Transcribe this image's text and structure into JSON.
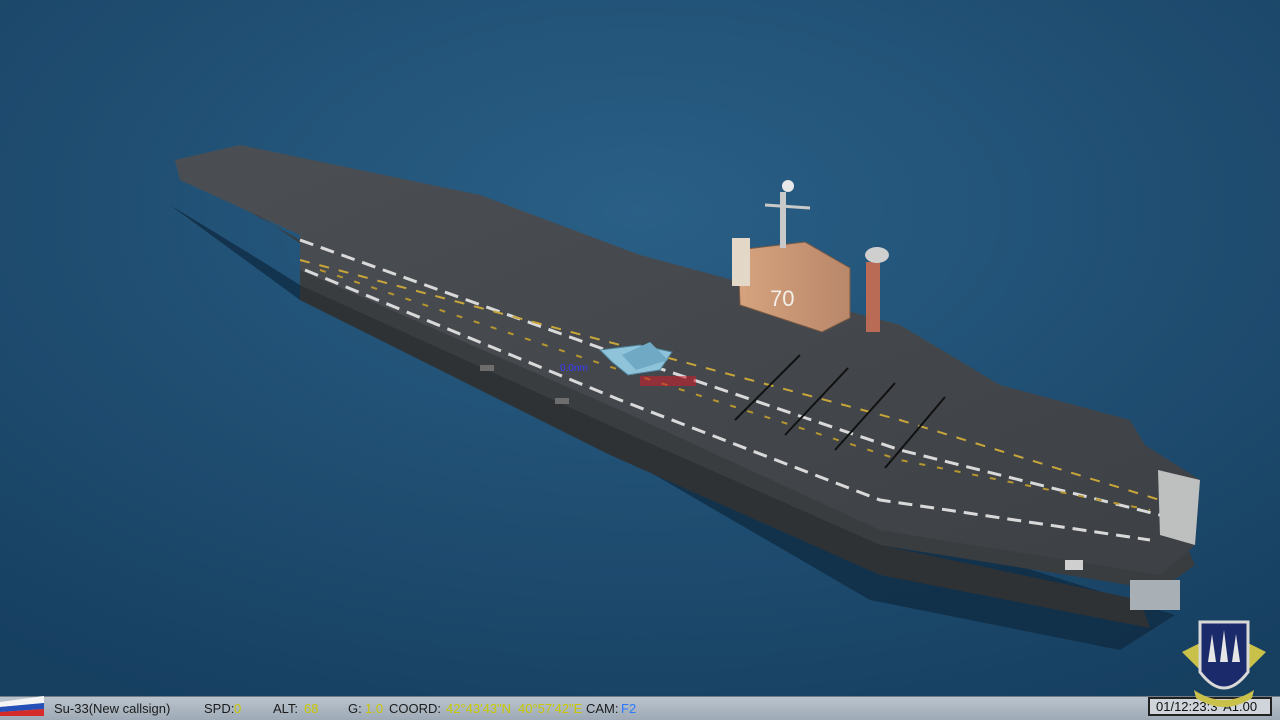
{
  "hud": {
    "aircraft_label": "Su-33(New callsign)",
    "speed_label": "SPD:",
    "speed_value": "0",
    "altitude_label": "ALT:",
    "altitude_value": "68",
    "g_label": "G:",
    "g_value": "1.0",
    "coord_label": "COORD:",
    "coord_lat": "42°43'43\"N",
    "coord_lon": "40°57'42\"E",
    "camera_label": "CAM:",
    "camera_value": "F2",
    "mission_time": "01/12:23:3",
    "time_accel": "A1.00"
  },
  "scene": {
    "hull_number": "70",
    "target_range_label": "0.0nm",
    "flag_icon": "russia-flag-icon",
    "emblem_icon": "squadron-emblem-icon"
  },
  "colors": {
    "sea": "#1c4a6e",
    "deck": "#4a4e52",
    "hud_value": "#c8c800",
    "hud_camera": "#2c78ff",
    "marker": "#3b3bff"
  }
}
